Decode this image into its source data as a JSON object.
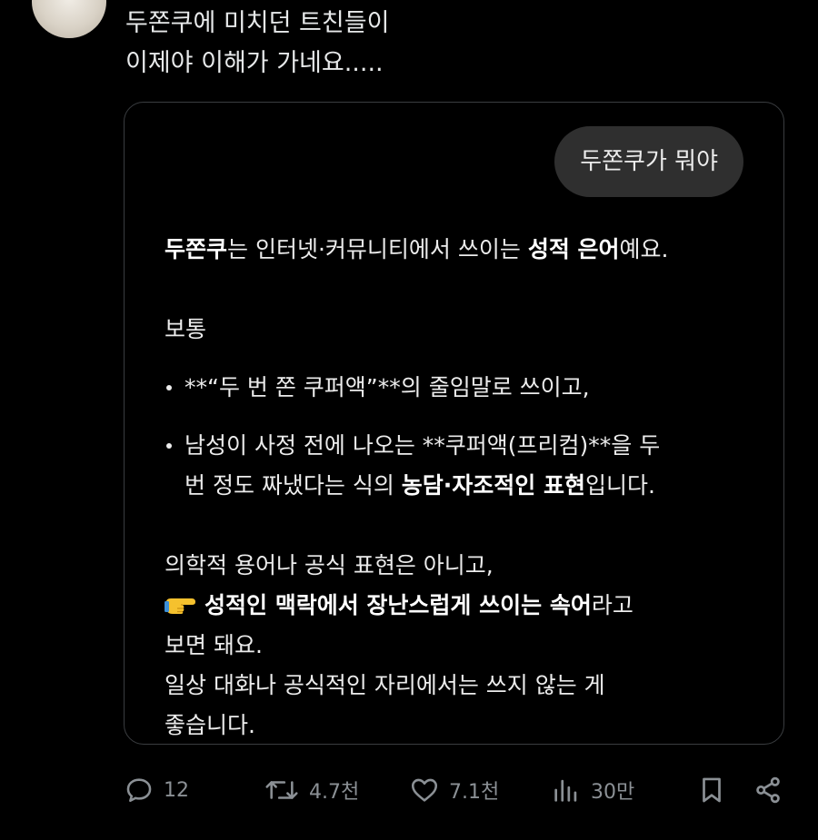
{
  "tweet": {
    "lines": [
      "두쫀쿠에 미치던 트친들이",
      "이제야 이해가 가네요....."
    ]
  },
  "card": {
    "question": "두쫀쿠가 뭐야",
    "answer": {
      "p1": {
        "bold1": "두쫀쿠",
        "text1": "는 인터넷·커뮤니티에서 쓰이는 ",
        "bold2": "성적 은어",
        "text2": "예요."
      },
      "p2": "보통",
      "bullet1": "**“두 번 쫀 쿠퍼액”**의 줄임말로 쓰이고,",
      "bullet2": {
        "line1": "남성이 사정 전에 나오는 **쿠퍼액(프리컴)**을 두",
        "line2_text": "번 정도 짜냈다는 식의 ",
        "line2_bold": "농담·자조적인 표현",
        "line2_end": "입니다."
      },
      "p3": {
        "line1": "의학적 용어나 공식 표현은 아니고,",
        "line2_bold": "성적인 맥락에서 장난스럽게 쓰이는 속어",
        "line2_end": "라고",
        "line3": "보면 돼요.",
        "line4": "일상 대화나 공식적인 자리에서는 쓰지 않는 게",
        "line5": "좋습니다."
      },
      "pointing_icon": "backhand-index-pointing-right-emoji"
    }
  },
  "actions": {
    "replies": "12",
    "retweets": "4.7천",
    "likes": "7.1천",
    "views": "30만"
  },
  "colors": {
    "background": "#000000",
    "text": "#e7e9ea",
    "muted": "#71767b",
    "bubble": "#2f2f2f",
    "border": "#3a3d40"
  }
}
